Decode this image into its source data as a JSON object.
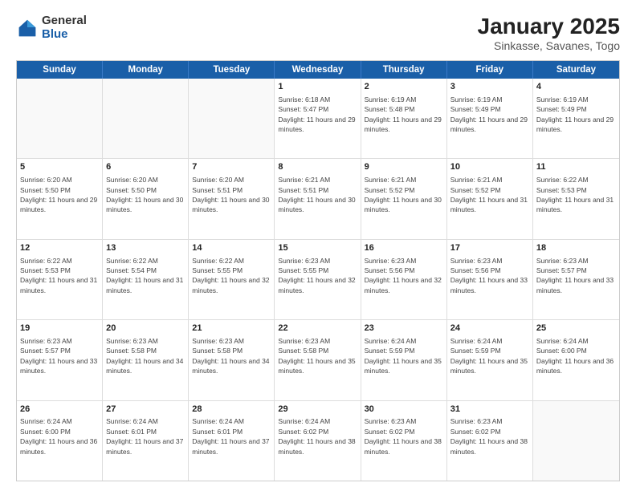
{
  "logo": {
    "general": "General",
    "blue": "Blue"
  },
  "title": "January 2025",
  "subtitle": "Sinkasse, Savanes, Togo",
  "days": [
    "Sunday",
    "Monday",
    "Tuesday",
    "Wednesday",
    "Thursday",
    "Friday",
    "Saturday"
  ],
  "weeks": [
    [
      {
        "day": "",
        "info": ""
      },
      {
        "day": "",
        "info": ""
      },
      {
        "day": "",
        "info": ""
      },
      {
        "day": "1",
        "info": "Sunrise: 6:18 AM\nSunset: 5:47 PM\nDaylight: 11 hours and 29 minutes."
      },
      {
        "day": "2",
        "info": "Sunrise: 6:19 AM\nSunset: 5:48 PM\nDaylight: 11 hours and 29 minutes."
      },
      {
        "day": "3",
        "info": "Sunrise: 6:19 AM\nSunset: 5:49 PM\nDaylight: 11 hours and 29 minutes."
      },
      {
        "day": "4",
        "info": "Sunrise: 6:19 AM\nSunset: 5:49 PM\nDaylight: 11 hours and 29 minutes."
      }
    ],
    [
      {
        "day": "5",
        "info": "Sunrise: 6:20 AM\nSunset: 5:50 PM\nDaylight: 11 hours and 29 minutes."
      },
      {
        "day": "6",
        "info": "Sunrise: 6:20 AM\nSunset: 5:50 PM\nDaylight: 11 hours and 30 minutes."
      },
      {
        "day": "7",
        "info": "Sunrise: 6:20 AM\nSunset: 5:51 PM\nDaylight: 11 hours and 30 minutes."
      },
      {
        "day": "8",
        "info": "Sunrise: 6:21 AM\nSunset: 5:51 PM\nDaylight: 11 hours and 30 minutes."
      },
      {
        "day": "9",
        "info": "Sunrise: 6:21 AM\nSunset: 5:52 PM\nDaylight: 11 hours and 30 minutes."
      },
      {
        "day": "10",
        "info": "Sunrise: 6:21 AM\nSunset: 5:52 PM\nDaylight: 11 hours and 31 minutes."
      },
      {
        "day": "11",
        "info": "Sunrise: 6:22 AM\nSunset: 5:53 PM\nDaylight: 11 hours and 31 minutes."
      }
    ],
    [
      {
        "day": "12",
        "info": "Sunrise: 6:22 AM\nSunset: 5:53 PM\nDaylight: 11 hours and 31 minutes."
      },
      {
        "day": "13",
        "info": "Sunrise: 6:22 AM\nSunset: 5:54 PM\nDaylight: 11 hours and 31 minutes."
      },
      {
        "day": "14",
        "info": "Sunrise: 6:22 AM\nSunset: 5:55 PM\nDaylight: 11 hours and 32 minutes."
      },
      {
        "day": "15",
        "info": "Sunrise: 6:23 AM\nSunset: 5:55 PM\nDaylight: 11 hours and 32 minutes."
      },
      {
        "day": "16",
        "info": "Sunrise: 6:23 AM\nSunset: 5:56 PM\nDaylight: 11 hours and 32 minutes."
      },
      {
        "day": "17",
        "info": "Sunrise: 6:23 AM\nSunset: 5:56 PM\nDaylight: 11 hours and 33 minutes."
      },
      {
        "day": "18",
        "info": "Sunrise: 6:23 AM\nSunset: 5:57 PM\nDaylight: 11 hours and 33 minutes."
      }
    ],
    [
      {
        "day": "19",
        "info": "Sunrise: 6:23 AM\nSunset: 5:57 PM\nDaylight: 11 hours and 33 minutes."
      },
      {
        "day": "20",
        "info": "Sunrise: 6:23 AM\nSunset: 5:58 PM\nDaylight: 11 hours and 34 minutes."
      },
      {
        "day": "21",
        "info": "Sunrise: 6:23 AM\nSunset: 5:58 PM\nDaylight: 11 hours and 34 minutes."
      },
      {
        "day": "22",
        "info": "Sunrise: 6:23 AM\nSunset: 5:58 PM\nDaylight: 11 hours and 35 minutes."
      },
      {
        "day": "23",
        "info": "Sunrise: 6:24 AM\nSunset: 5:59 PM\nDaylight: 11 hours and 35 minutes."
      },
      {
        "day": "24",
        "info": "Sunrise: 6:24 AM\nSunset: 5:59 PM\nDaylight: 11 hours and 35 minutes."
      },
      {
        "day": "25",
        "info": "Sunrise: 6:24 AM\nSunset: 6:00 PM\nDaylight: 11 hours and 36 minutes."
      }
    ],
    [
      {
        "day": "26",
        "info": "Sunrise: 6:24 AM\nSunset: 6:00 PM\nDaylight: 11 hours and 36 minutes."
      },
      {
        "day": "27",
        "info": "Sunrise: 6:24 AM\nSunset: 6:01 PM\nDaylight: 11 hours and 37 minutes."
      },
      {
        "day": "28",
        "info": "Sunrise: 6:24 AM\nSunset: 6:01 PM\nDaylight: 11 hours and 37 minutes."
      },
      {
        "day": "29",
        "info": "Sunrise: 6:24 AM\nSunset: 6:02 PM\nDaylight: 11 hours and 38 minutes."
      },
      {
        "day": "30",
        "info": "Sunrise: 6:23 AM\nSunset: 6:02 PM\nDaylight: 11 hours and 38 minutes."
      },
      {
        "day": "31",
        "info": "Sunrise: 6:23 AM\nSunset: 6:02 PM\nDaylight: 11 hours and 38 minutes."
      },
      {
        "day": "",
        "info": ""
      }
    ]
  ]
}
